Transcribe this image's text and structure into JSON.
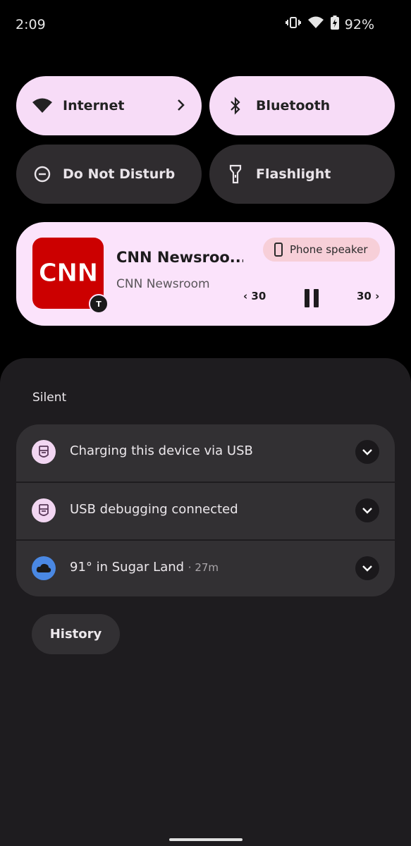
{
  "status_bar": {
    "time": "2:09",
    "battery": "92%"
  },
  "quick_settings": {
    "internet": "Internet",
    "bluetooth": "Bluetooth",
    "do_not_disturb": "Do Not Disturb",
    "flashlight": "Flashlight"
  },
  "media": {
    "artwork_text": "CNN",
    "title": "CNN Newsroo...",
    "subtitle": "CNN Newsroom",
    "output": "Phone speaker",
    "rewind": "‹ 30",
    "forward": "30 ›",
    "app_badge": "T"
  },
  "notifications": {
    "section": "Silent",
    "items": [
      {
        "text": "Charging this device via USB"
      },
      {
        "text": "USB debugging connected"
      },
      {
        "text": "91° in Sugar Land",
        "time": "· 27m"
      }
    ],
    "history": "History"
  },
  "colors": {
    "tile_on": "#f7dcf7",
    "tile_off": "#2f2c2f",
    "media_bg": "#fbe3fb",
    "cnn_red": "#cc0000",
    "shade_bg": "#1e1c1f"
  }
}
